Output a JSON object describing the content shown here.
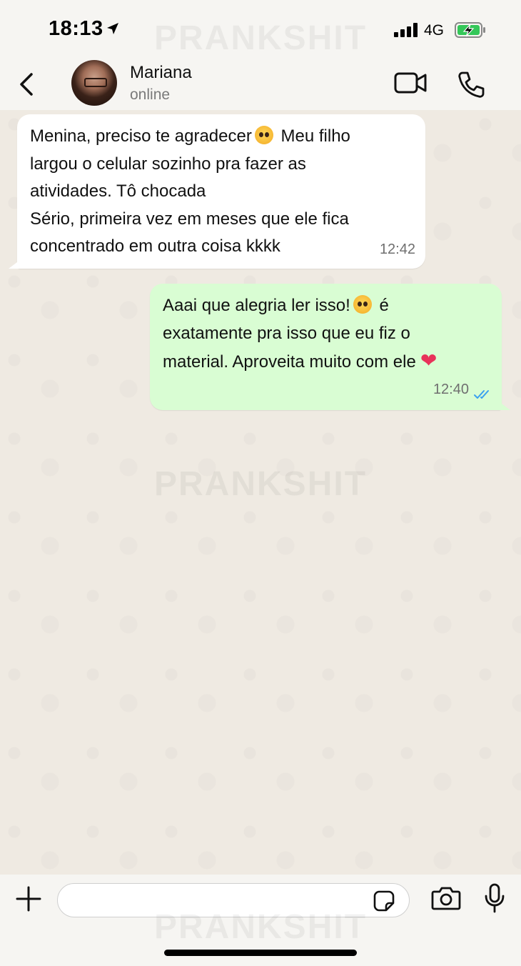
{
  "status_bar": {
    "time": "18:13",
    "network": "4G"
  },
  "watermark": "PRANKSHIT",
  "header": {
    "contact_name": "Mariana",
    "contact_status": "online"
  },
  "messages": [
    {
      "direction": "incoming",
      "lines": [
        "Menina, preciso te agradecer",
        "largou o celular sozinho pra fazer as",
        "atividades. Tô chocada",
        "Sério, primeira vez em meses que ele fica",
        "concentrado em outra coisa kkkk"
      ],
      "line1_tail": "Meu filho",
      "time": "12:42"
    },
    {
      "direction": "outgoing",
      "lines": [
        "Aaai que alegria ler isso!",
        "exatamente pra isso que eu fiz o",
        "material. Aproveita muito com ele"
      ],
      "line1_tail": "é",
      "time": "12:40",
      "read": true
    }
  ],
  "composer": {
    "placeholder": ""
  },
  "colors": {
    "incoming_bubble": "#ffffff",
    "outgoing_bubble": "#d9fdd3",
    "read_ticks": "#3aa0f0",
    "heart": "#e8325a"
  }
}
